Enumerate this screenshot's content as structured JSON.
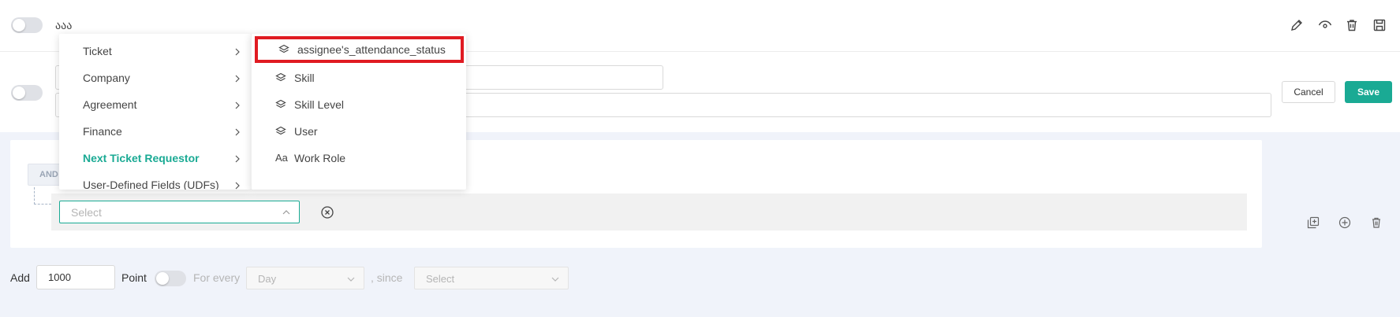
{
  "top_row": {
    "title": "ააა"
  },
  "edit_block": {
    "cancel_label": "Cancel",
    "save_label": "Save"
  },
  "conditions": {
    "operator_label": "AND",
    "field_placeholder": "Select"
  },
  "points": {
    "add_label": "Add",
    "amount": "1000",
    "point_label": "Point",
    "for_every_label": "For every",
    "period_value": "Day",
    "since_label": ", since",
    "since_placeholder": "Select"
  },
  "cascader": {
    "categories": [
      {
        "label": "Ticket",
        "active": false
      },
      {
        "label": "Company",
        "active": false
      },
      {
        "label": "Agreement",
        "active": false
      },
      {
        "label": "Finance",
        "active": false
      },
      {
        "label": "Next Ticket Requestor",
        "active": true
      },
      {
        "label": "User-Defined Fields (UDFs)",
        "active": false
      }
    ],
    "sub_items": [
      {
        "label": "assignee's_attendance_status",
        "icon": "layers-icon",
        "highlighted": true
      },
      {
        "label": "Skill",
        "icon": "layers-icon",
        "highlighted": false
      },
      {
        "label": "Skill Level",
        "icon": "layers-icon",
        "highlighted": false
      },
      {
        "label": "User",
        "icon": "layers-icon",
        "highlighted": false
      },
      {
        "label": "Work Role",
        "icon": "text-type-icon",
        "highlighted": false
      }
    ]
  },
  "colors": {
    "accent": "#1aaa94",
    "highlight_border": "#e01b22",
    "panel_background": "#f0f3fa"
  }
}
